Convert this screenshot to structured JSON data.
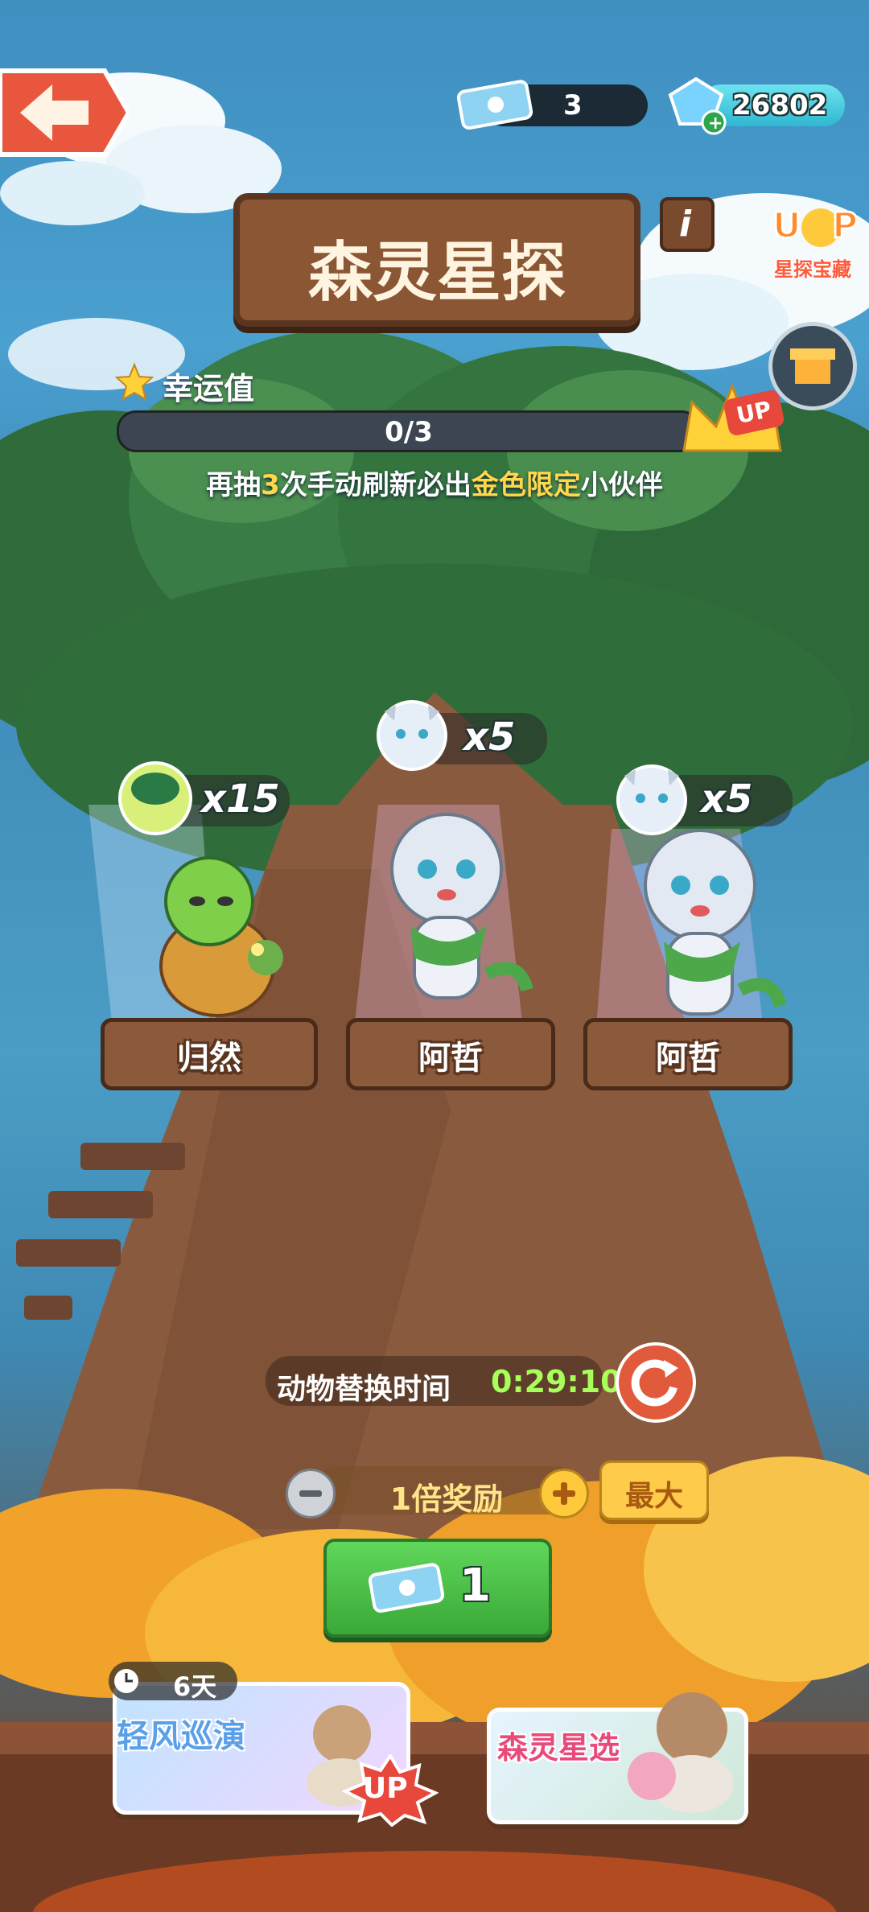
{
  "header": {
    "ticket_count": "3",
    "gem_count": "26802",
    "title": "森灵星探"
  },
  "treasure": {
    "label": "星探宝藏",
    "badge": "UP"
  },
  "luck": {
    "label": "幸运值",
    "progress_text": "0/3",
    "progress": 0,
    "hint_prefix": "再抽",
    "hint_num": "3",
    "hint_mid": "次手动刷新必出",
    "hint_gold": "金色限定",
    "hint_suffix": "小伙伴",
    "crown_badge": "UP"
  },
  "pods": [
    {
      "name": "归然",
      "reward": "x15",
      "reward_icon": "turtle-shell-icon"
    },
    {
      "name": "阿哲",
      "reward": "x5",
      "reward_icon": "tiger-head-icon"
    },
    {
      "name": "阿哲",
      "reward": "x5",
      "reward_icon": "tiger-head-icon"
    }
  ],
  "timer": {
    "label": "动物替换时间",
    "value": "0:29:10"
  },
  "multiplier": {
    "label": "1倍奖励",
    "max_label": "最大"
  },
  "draw": {
    "cost": "1"
  },
  "events": [
    {
      "title": "轻风巡演",
      "days": "6天",
      "badge": "UP"
    },
    {
      "title": "森灵星选"
    }
  ],
  "colors": {
    "accent_green": "#4cc04a",
    "gold": "#ffd84a",
    "timer_green": "#a8ff5a",
    "reset_red": "#e25a3c"
  }
}
